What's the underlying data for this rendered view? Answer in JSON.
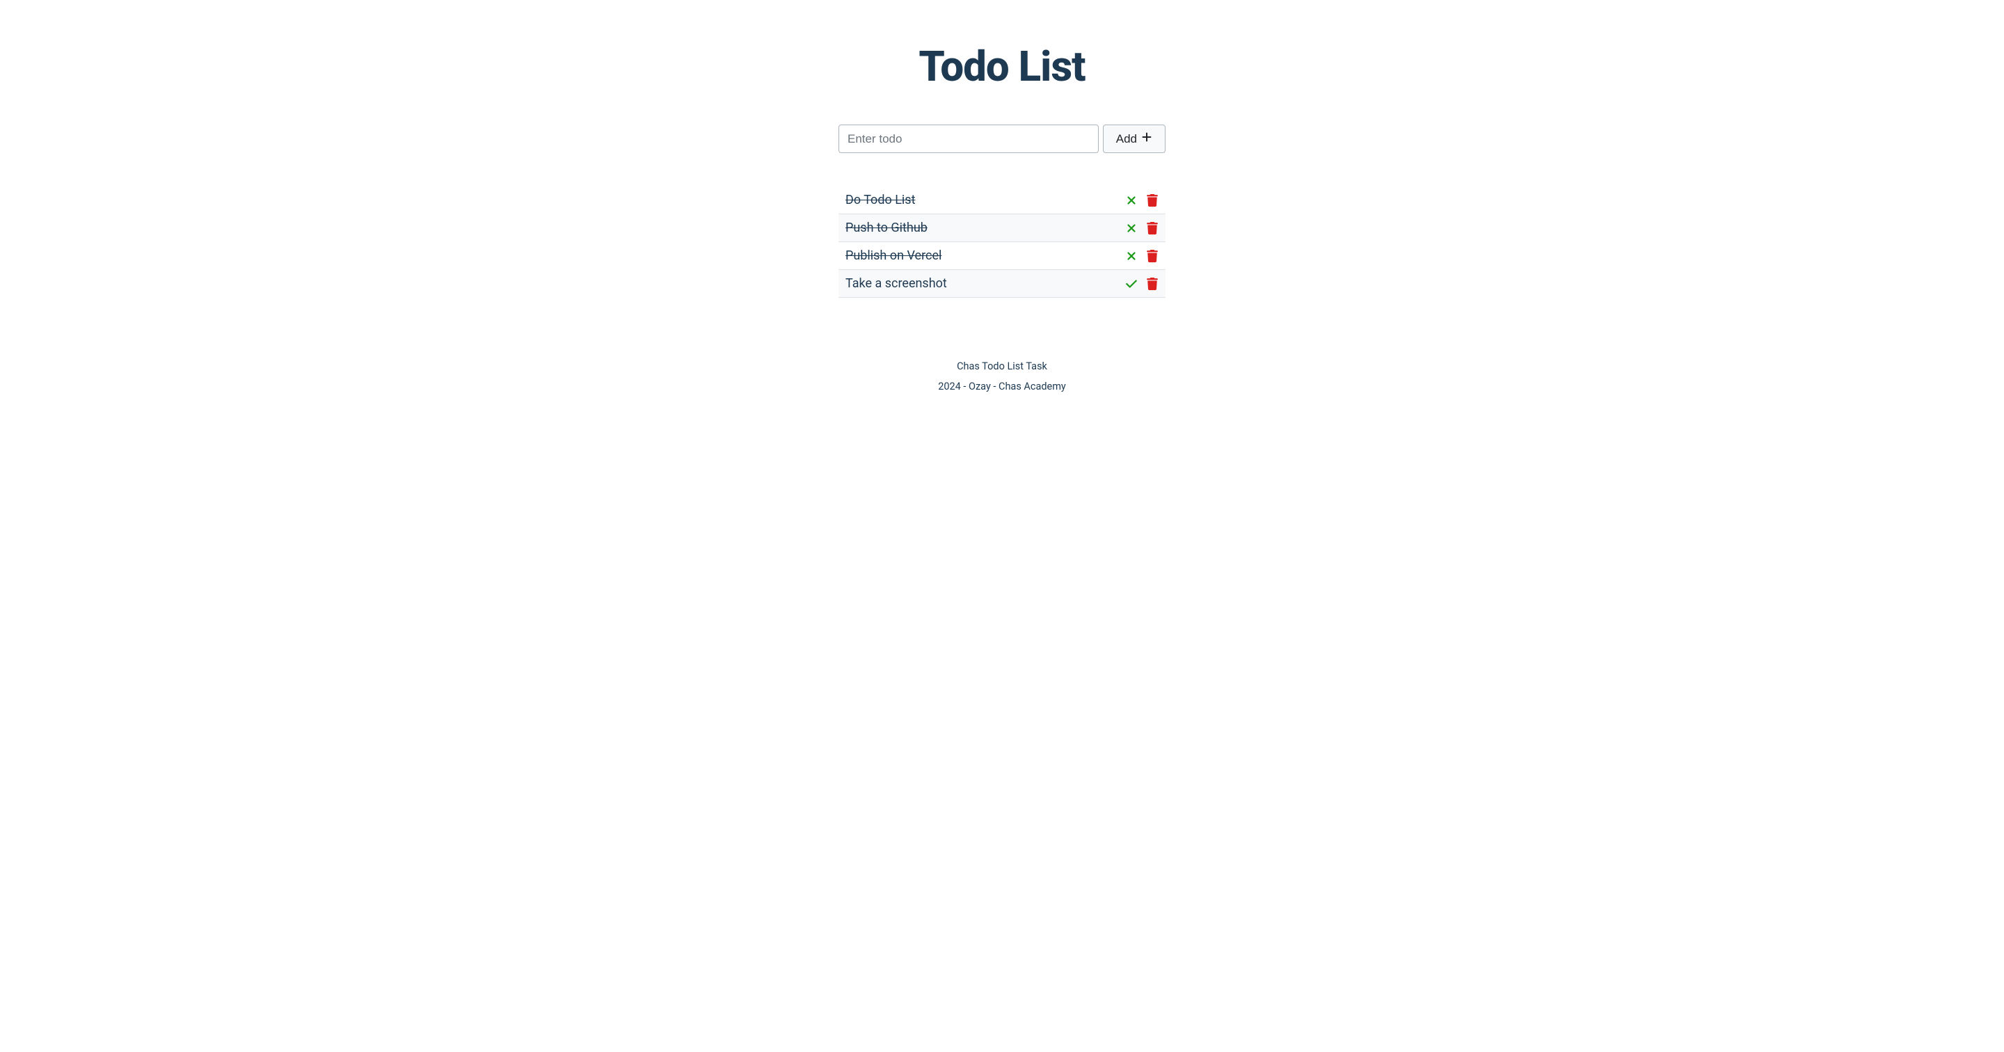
{
  "header": {
    "title": "Todo List"
  },
  "input": {
    "placeholder": "Enter todo",
    "add_label": "Add"
  },
  "todos": [
    {
      "text": "Do Todo List",
      "done": true
    },
    {
      "text": "Push to Github",
      "done": true
    },
    {
      "text": "Publish on Vercel",
      "done": true
    },
    {
      "text": "Take a screenshot",
      "done": false
    }
  ],
  "footer": {
    "line1": "Chas Todo List Task",
    "line2": "2024 - Ozay - Chas Academy"
  }
}
